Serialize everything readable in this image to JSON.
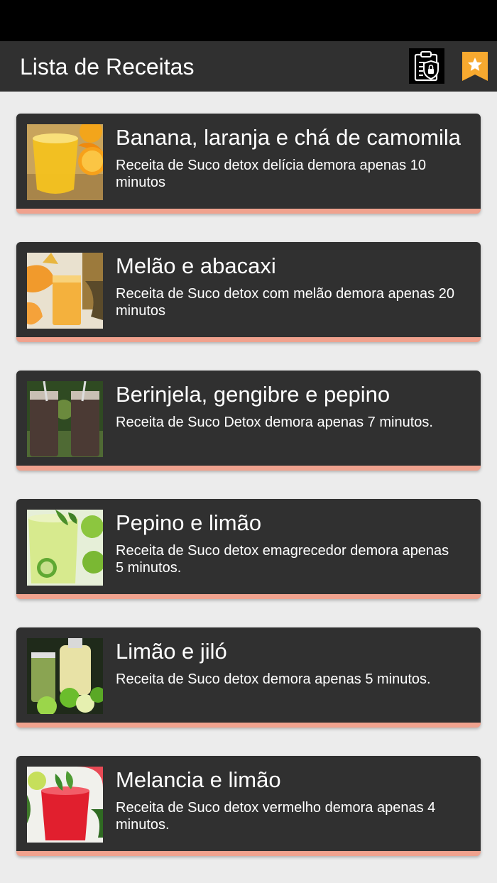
{
  "app_bar": {
    "title": "Lista de Receitas",
    "privacy_icon": "privacy-policy-clipboard-icon",
    "favorite_icon": "star-bookmark-icon"
  },
  "colors": {
    "app_bar": "#303030",
    "card": "#303030",
    "card_accent": "#f0a28e",
    "favorite": "#f7a92f",
    "background": "#ececec"
  },
  "recipes": [
    {
      "title": "Banana, laranja e chá de camomila",
      "description": "Receita de Suco detox delícia demora apenas 10 minutos",
      "image_icon": "orange-juice-image"
    },
    {
      "title": "Melão e abacaxi",
      "description": "Receita de Suco detox com melão demora apenas 20 minutos",
      "image_icon": "melon-pineapple-juice-image"
    },
    {
      "title": "Berinjela, gengibre e pepino",
      "description": "Receita de Suco Detox demora apenas 7 minutos.",
      "image_icon": "eggplant-juice-image"
    },
    {
      "title": "Pepino e limão",
      "description": "Receita de Suco detox emagrecedor demora apenas 5 minutos.",
      "image_icon": "cucumber-lemon-juice-image"
    },
    {
      "title": "Limão e jiló",
      "description": "Receita de Suco detox demora apenas 5 minutos.",
      "image_icon": "lime-jilo-juice-image"
    },
    {
      "title": "Melancia e limão",
      "description": "Receita de Suco detox vermelho demora apenas 4 minutos.",
      "image_icon": "watermelon-lemon-juice-image"
    }
  ]
}
